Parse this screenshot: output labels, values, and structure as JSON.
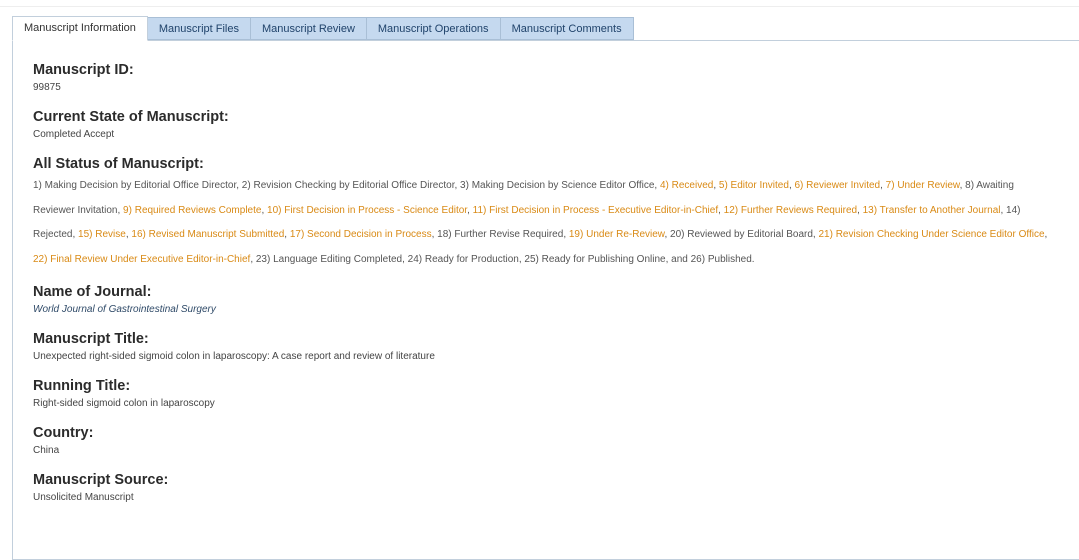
{
  "tabs": [
    {
      "label": "Manuscript Information"
    },
    {
      "label": "Manuscript Files"
    },
    {
      "label": "Manuscript Review"
    },
    {
      "label": "Manuscript Operations"
    },
    {
      "label": "Manuscript Comments"
    }
  ],
  "manuscript": {
    "id_label": "Manuscript ID:",
    "id_value": "99875",
    "state_label": "Current State of Manuscript:",
    "state_value": "Completed Accept",
    "status_label": "All Status of Manuscript:",
    "status_items": [
      {
        "text": "1) Making Decision by Editorial Office Director",
        "highlight": false
      },
      {
        "text": "2) Revision Checking by Editorial Office Director",
        "highlight": false
      },
      {
        "text": "3) Making Decision by Science Editor Office",
        "highlight": false
      },
      {
        "text": "4) Received",
        "highlight": true
      },
      {
        "text": "5) Editor Invited",
        "highlight": true
      },
      {
        "text": "6) Reviewer Invited",
        "highlight": true
      },
      {
        "text": "7) Under Review",
        "highlight": true
      },
      {
        "text": "8) Awaiting Reviewer Invitation",
        "highlight": false
      },
      {
        "text": "9) Required Reviews Complete",
        "highlight": true
      },
      {
        "text": "10) First Decision in Process - Science Editor",
        "highlight": true
      },
      {
        "text": "11) First Decision in Process - Executive Editor-in-Chief",
        "highlight": true
      },
      {
        "text": "12) Further Reviews Required",
        "highlight": true
      },
      {
        "text": "13) Transfer to Another Journal",
        "highlight": true
      },
      {
        "text": "14) Rejected",
        "highlight": false
      },
      {
        "text": "15) Revise",
        "highlight": true
      },
      {
        "text": "16) Revised Manuscript Submitted",
        "highlight": true
      },
      {
        "text": "17) Second Decision in Process",
        "highlight": true
      },
      {
        "text": "18) Further Revise Required",
        "highlight": false
      },
      {
        "text": "19) Under Re-Review",
        "highlight": true
      },
      {
        "text": "20) Reviewed by Editorial Board",
        "highlight": false
      },
      {
        "text": "21) Revision Checking Under Science Editor Office",
        "highlight": true
      },
      {
        "text": "22) Final Review Under Executive Editor-in-Chief",
        "highlight": true
      },
      {
        "text": "23) Language Editing Completed",
        "highlight": false
      },
      {
        "text": "24) Ready for Production",
        "highlight": false
      },
      {
        "text": "25) Ready for Publishing Online",
        "highlight": false
      },
      {
        "text": "26) Published.",
        "highlight": false
      }
    ],
    "journal_label": "Name of Journal:",
    "journal_value": "World Journal of Gastrointestinal Surgery",
    "title_label": "Manuscript Title:",
    "title_value": "Unexpected right-sided sigmoid colon in laparoscopy: A case report and review of literature",
    "running_label": "Running Title:",
    "running_value": "Right-sided sigmoid colon in laparoscopy",
    "country_label": "Country:",
    "country_value": "China",
    "source_label": "Manuscript Source:",
    "source_value": "Unsolicited Manuscript"
  },
  "colors": {
    "highlight": "#d98a15",
    "tab_bg": "#c5d9ef"
  }
}
